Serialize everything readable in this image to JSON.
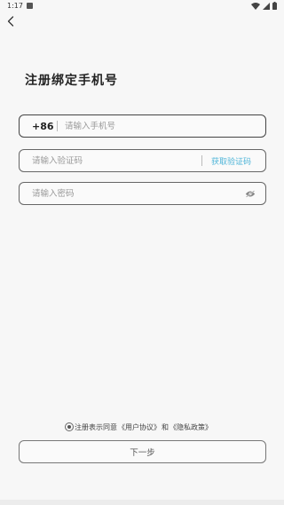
{
  "status_bar": {
    "time": "1:17",
    "icons": [
      "notification-icon",
      "wifi-icon",
      "signal-icon",
      "battery-icon"
    ]
  },
  "header": {
    "back_icon": "chevron-left-icon"
  },
  "main": {
    "title": "注册绑定手机号",
    "phone": {
      "prefix": "+86",
      "placeholder": "请输入手机号",
      "value": ""
    },
    "code": {
      "placeholder": "请输入验证码",
      "value": "",
      "get_code_label": "获取验证码"
    },
    "password": {
      "placeholder": "请输入密码",
      "value": "",
      "toggle_icon": "eye-off-icon"
    }
  },
  "footer": {
    "agree_prefix": "注册表示同意",
    "user_agreement": "《用户协议》",
    "and": "和",
    "privacy_policy": "《隐私政策》",
    "agreed": true,
    "next_label": "下一步"
  },
  "colors": {
    "accent": "#4fb5d8",
    "background": "#f7f7f7",
    "border": "#555555"
  }
}
